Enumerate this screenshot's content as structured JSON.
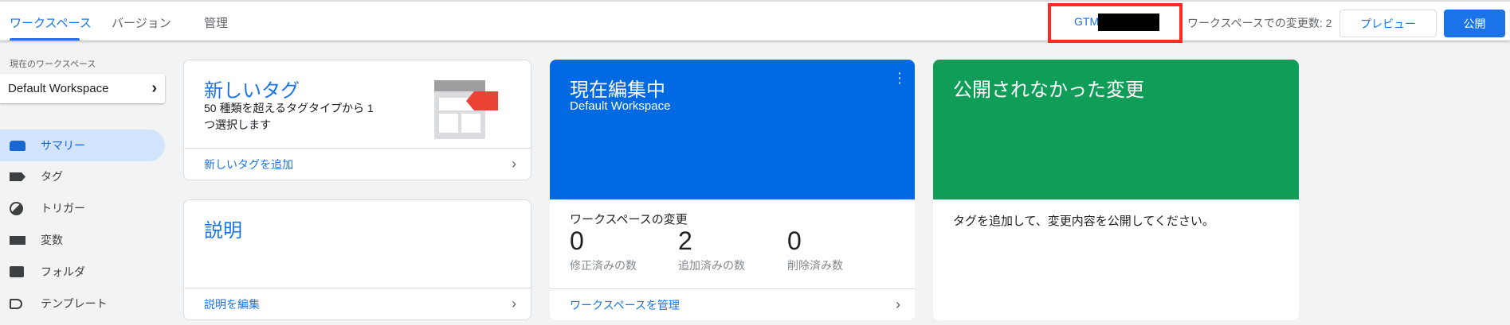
{
  "header": {
    "tabs": [
      {
        "label": "ワークスペース",
        "active": true
      },
      {
        "label": "バージョン"
      },
      {
        "label": "管理"
      }
    ],
    "container_id": "GTM-",
    "changes_text": "ワークスペースでの変更数: 2",
    "preview_label": "プレビュー",
    "publish_label": "公開"
  },
  "sidebar": {
    "current_label": "現在のワークスペース",
    "workspace": "Default Workspace",
    "items": [
      {
        "label": "サマリー",
        "icon": "summary-icon"
      },
      {
        "label": "タグ",
        "icon": "tag-icon"
      },
      {
        "label": "トリガー",
        "icon": "trigger-icon"
      },
      {
        "label": "変数",
        "icon": "variable-icon"
      },
      {
        "label": "フォルダ",
        "icon": "folder-icon"
      },
      {
        "label": "テンプレート",
        "icon": "template-icon"
      }
    ]
  },
  "new_tag": {
    "title": "新しいタグ",
    "desc": "50 種類を超えるタグタイプから 1 つ選択します",
    "link": "新しいタグを追加"
  },
  "description": {
    "title": "説明",
    "link": "説明を編集"
  },
  "editing": {
    "title": "現在編集中",
    "workspace": "Default Workspace",
    "changes_title": "ワークスペースの変更",
    "stats": [
      {
        "value": "0",
        "label": "修正済みの数"
      },
      {
        "value": "2",
        "label": "追加済みの数"
      },
      {
        "value": "0",
        "label": "削除済み数"
      }
    ],
    "link": "ワークスペースを管理"
  },
  "unpublished": {
    "title": "公開されなかった変更",
    "message": "タグを追加して、変更内容を公開してください。"
  },
  "colors": {
    "accent": "#1a73e8",
    "blue_card": "#0169e1",
    "green_card": "#0f9d58",
    "highlight": "#ff2a20"
  }
}
